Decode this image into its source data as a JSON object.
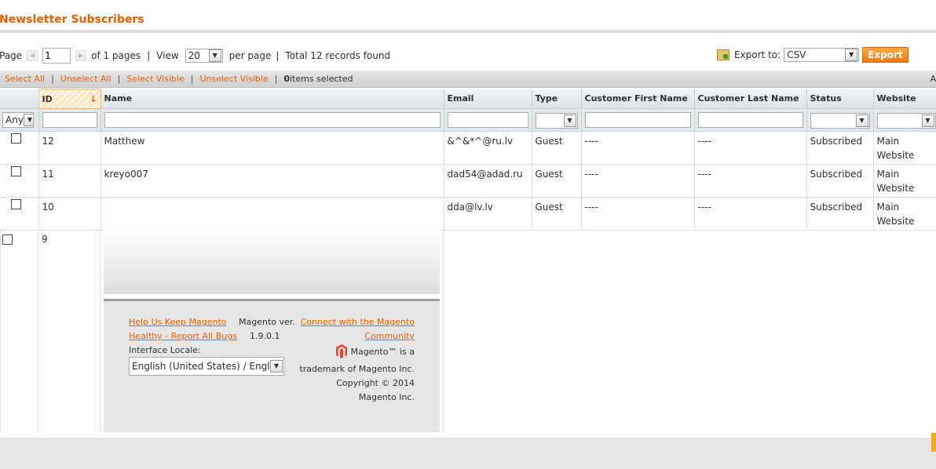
{
  "page": {
    "title": "Newsletter Subscribers"
  },
  "pager": {
    "page_label": "Page",
    "page_value": "1",
    "of_pages": "of 1 pages",
    "view_label": "View",
    "per_page_value": "20",
    "per_page_label": "per page",
    "total": "Total 12 records found"
  },
  "export": {
    "label": "Export to:",
    "format": "CSV",
    "button": "Export"
  },
  "massaction": {
    "select_all": "Select All",
    "unselect_all": "Unselect All",
    "select_visible": "Select Visible",
    "unselect_visible": "Unselect Visible",
    "selected_count": "0",
    "selected_suffix": " items selected",
    "actions_label": "Ac"
  },
  "grid": {
    "columns": [
      "ID",
      "Name",
      "Email",
      "Type",
      "Customer First Name",
      "Customer Last Name",
      "Status",
      "Website"
    ],
    "filter_any": "Any",
    "rows": [
      {
        "id": "12",
        "name": "Matthew",
        "email": "&^&*^@ru.lv",
        "type": "Guest",
        "first": "----",
        "last": "----",
        "status": "Subscribed",
        "website": "Main Website"
      },
      {
        "id": "11",
        "name": "kreyo007",
        "email": "dad54@adad.ru",
        "type": "Guest",
        "first": "----",
        "last": "----",
        "status": "Subscribed",
        "website": "Main Website"
      },
      {
        "id": "10",
        "name": "",
        "email": "dda@lv.lv",
        "type": "Guest",
        "first": "----",
        "last": "----",
        "status": "Subscribed",
        "website": "Main Website"
      },
      {
        "id": "9"
      }
    ]
  },
  "footer": {
    "help_link": "Help Us Keep Magento",
    "report_link": "Healthy - Report All Bugs",
    "version_label": "Magento ver.",
    "version_value": "1.9.0.1",
    "connect_line1": "Connect with the Magento",
    "connect_line2": "Community",
    "locale_label": "Interface Locale:",
    "locale_value": "English (United States) / English",
    "tm_line1": "Magento™ is a",
    "tm_line2": "trademark of Magento Inc.",
    "copyright": "Copyright © 2014",
    "company": "Magento Inc."
  },
  "colors": {
    "accent": "#eb5e00",
    "export_button": "#f58a1f",
    "header_bg": "#e3e8eb"
  }
}
